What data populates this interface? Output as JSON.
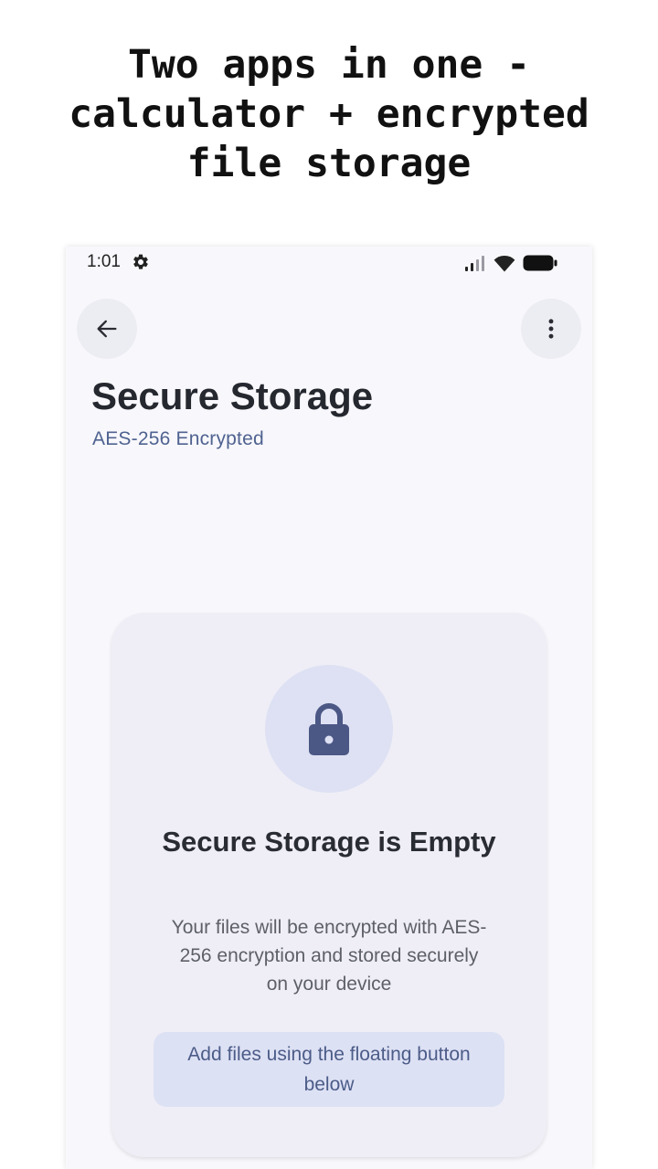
{
  "headline": {
    "line1": "Two apps in one -",
    "line2": "calculator + encrypted",
    "line3": "file storage"
  },
  "status_bar": {
    "time": "1:01",
    "icons": [
      "settings-gear-icon",
      "signal-icon",
      "wifi-icon",
      "battery-icon"
    ]
  },
  "toolbar": {
    "back_icon": "arrow-back-icon",
    "more_icon": "more-vert-icon"
  },
  "page": {
    "title": "Secure Storage",
    "subtitle": "AES-256 Encrypted"
  },
  "empty_state": {
    "icon": "lock-icon",
    "title": "Secure Storage is Empty",
    "description": "Your files will be encrypted with AES-256 encryption and stored securely on your device",
    "hint": "Add files using the floating button below"
  },
  "colors": {
    "accent": "#4f6290",
    "lock": "#4b5785",
    "card_bg": "#efeef6",
    "hint_bg": "#dde1f4"
  }
}
